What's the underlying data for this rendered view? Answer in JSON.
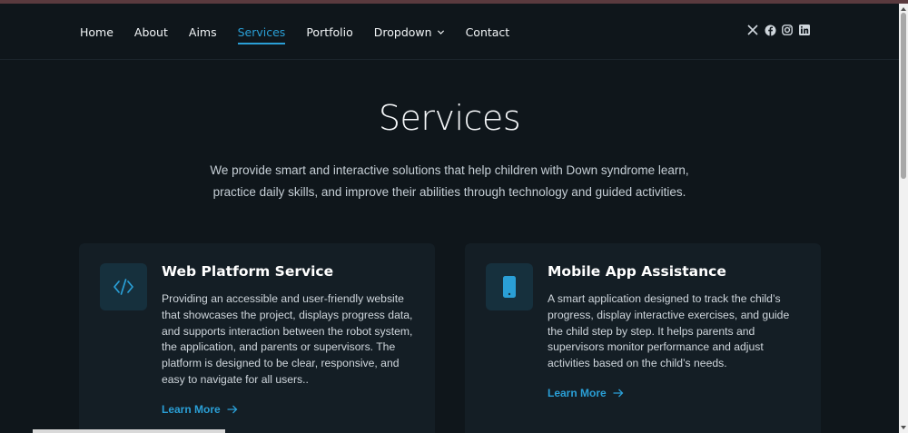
{
  "nav": {
    "items": [
      {
        "label": "Home"
      },
      {
        "label": "About"
      },
      {
        "label": "Aims"
      },
      {
        "label": "Services",
        "active": true
      },
      {
        "label": "Portfolio"
      },
      {
        "label": "Dropdown"
      },
      {
        "label": "Contact"
      }
    ]
  },
  "social": [
    "x-icon",
    "facebook-icon",
    "instagram-icon",
    "linkedin-icon"
  ],
  "hero": {
    "title": "Services",
    "description": "We provide smart and interactive solutions that help children with Down syndrome learn, practice daily skills, and improve their abilities through technology and guided activities."
  },
  "cards": [
    {
      "icon": "code-icon",
      "title": "Web Platform Service",
      "description": "Providing an accessible and user-friendly website that showcases the project, displays progress data, and supports interaction between the robot system, the application, and parents or supervisors. The platform is designed to be clear, responsive, and easy to navigate for all users..",
      "link": "Learn More"
    },
    {
      "icon": "phone-icon",
      "title": "Mobile App Assistance",
      "description": "A smart application designed to track the child’s progress, display interactive exercises, and guide the child step by step. It helps parents and supervisors monitor performance and adjust activities based on the child’s needs.",
      "link": "Learn More"
    }
  ],
  "colors": {
    "accent": "#2a9fd6",
    "background": "#0f161b",
    "card": "#141e25"
  }
}
